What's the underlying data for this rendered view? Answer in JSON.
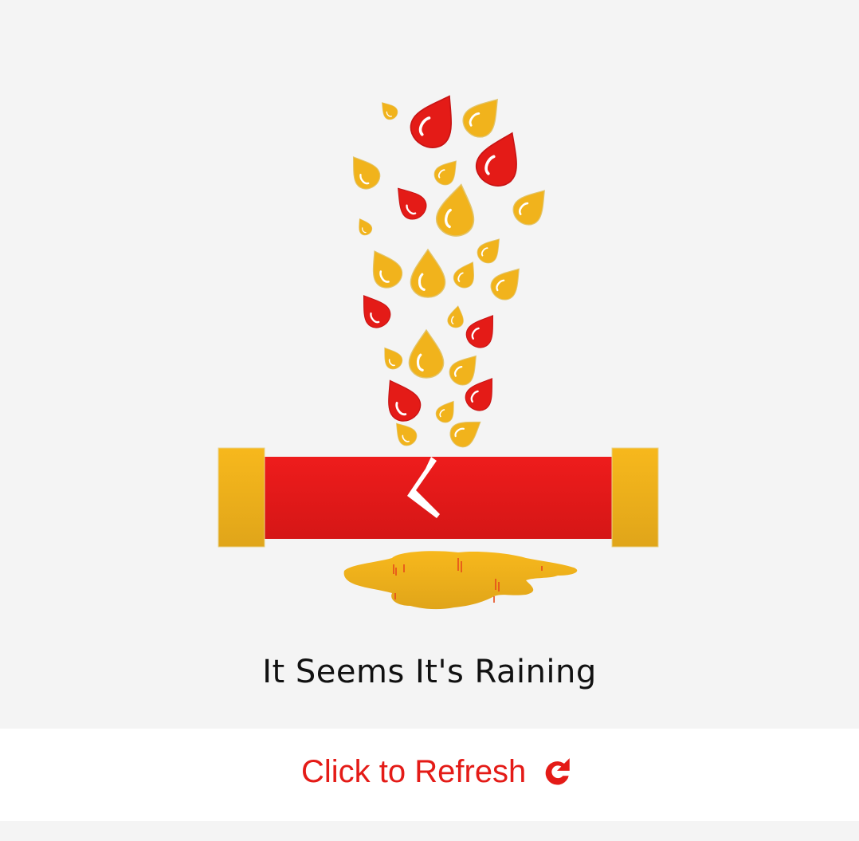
{
  "message": {
    "text": "It Seems It's Raining"
  },
  "refresh": {
    "label": "Click to Refresh",
    "icon": "refresh-icon"
  },
  "colors": {
    "background": "#f4f4f4",
    "pipe_red": "#e41b17",
    "pipe_yellow": "#f1b31c",
    "link_red": "#e41b17"
  }
}
